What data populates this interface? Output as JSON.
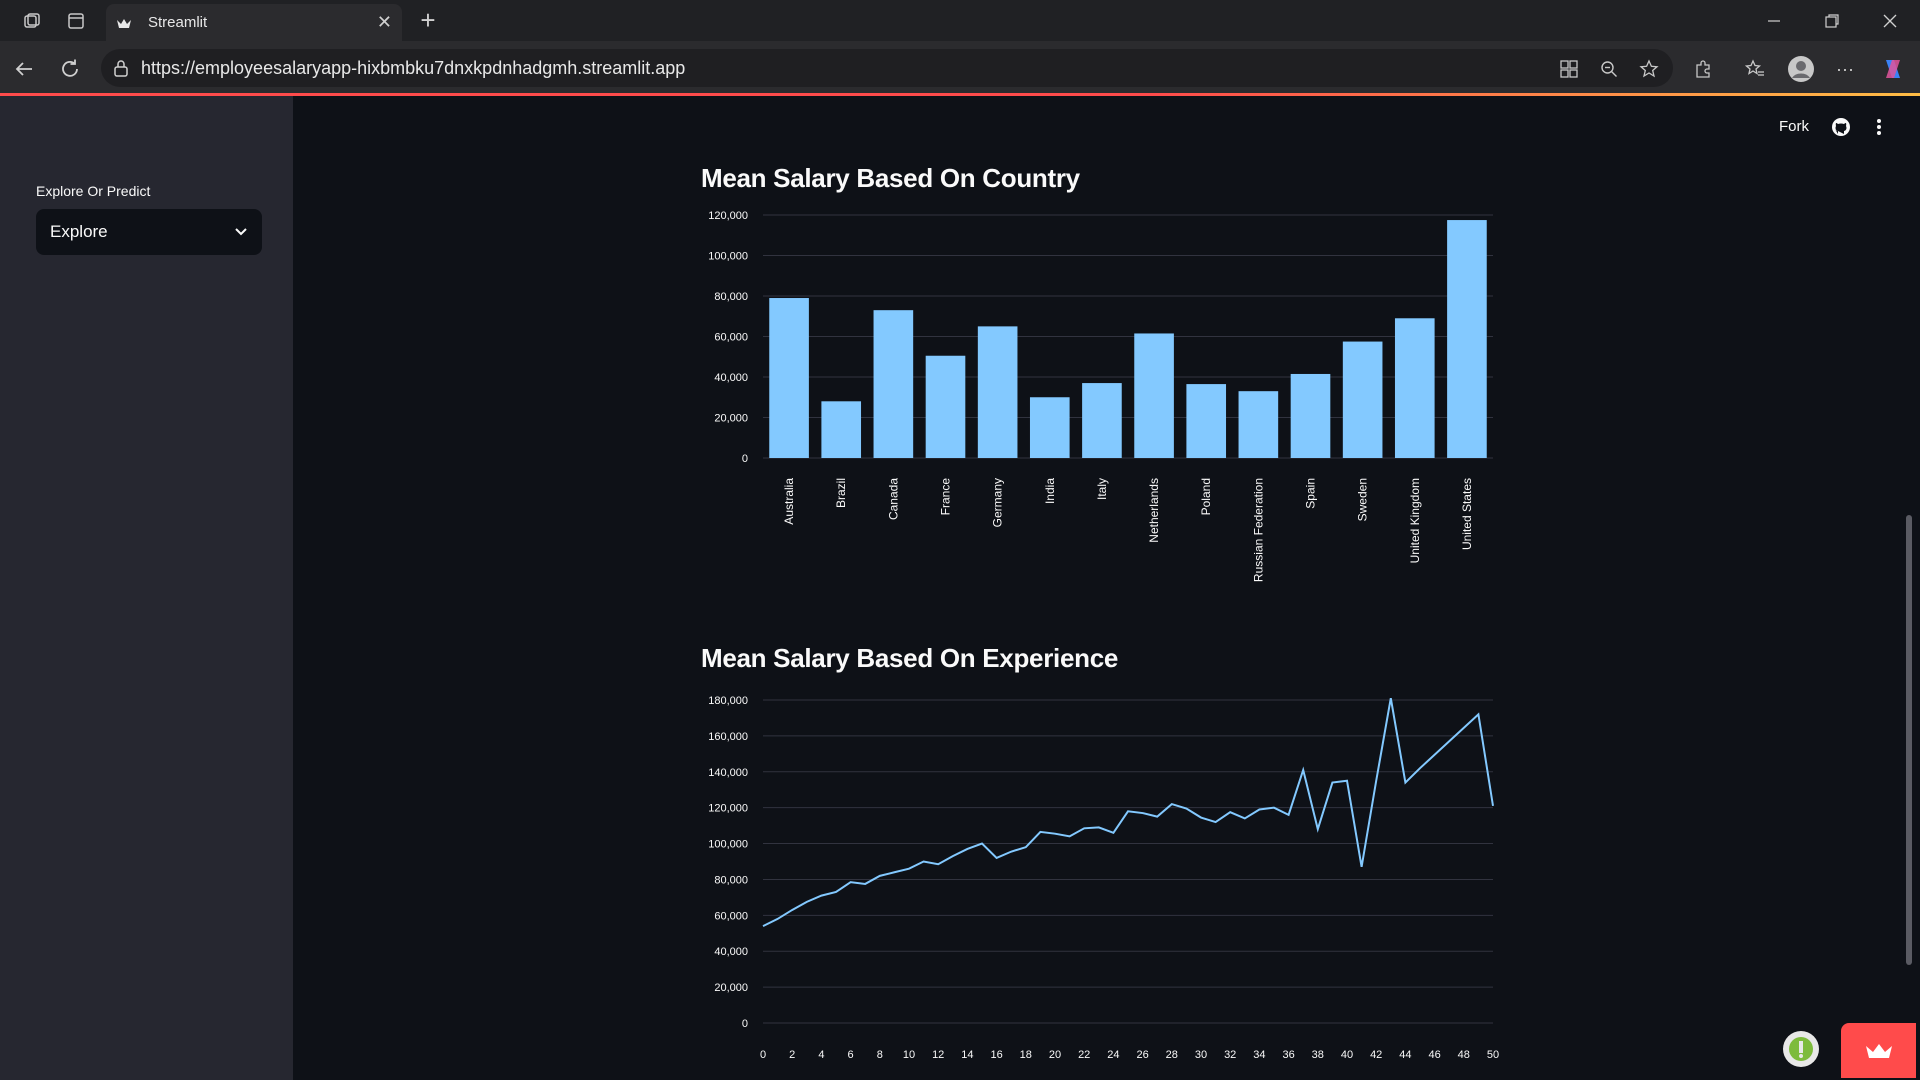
{
  "browser": {
    "tab_title": "Streamlit",
    "url": "https://employeesalaryapp-hixbmbku7dnxkpdnhadgmh.streamlit.app"
  },
  "sidebar": {
    "select_label": "Explore Or Predict",
    "select_value": "Explore"
  },
  "header": {
    "fork_label": "Fork"
  },
  "colors": {
    "accent": "#ff4b4b",
    "bar": "#83c9ff",
    "background": "#0e1117",
    "sidebar": "#262730"
  },
  "chart_data": [
    {
      "type": "bar",
      "title": "Mean Salary Based On Country",
      "categories": [
        "Australia",
        "Brazil",
        "Canada",
        "France",
        "Germany",
        "India",
        "Italy",
        "Netherlands",
        "Poland",
        "Russian Federation",
        "Spain",
        "Sweden",
        "United Kingdom",
        "United States"
      ],
      "values": [
        79000,
        28000,
        73000,
        50500,
        65000,
        30000,
        37000,
        61500,
        36500,
        33000,
        41500,
        57500,
        69000,
        117500
      ],
      "yticks": [
        "0",
        "20,000",
        "40,000",
        "60,000",
        "80,000",
        "100,000",
        "120,000"
      ],
      "ylim": [
        0,
        120000
      ],
      "grid": true
    },
    {
      "type": "line",
      "title": "Mean Salary Based On Experience",
      "x": [
        0,
        1,
        2,
        3,
        4,
        5,
        6,
        7,
        8,
        9,
        10,
        11,
        12,
        13,
        14,
        15,
        16,
        17,
        18,
        19,
        20,
        21,
        22,
        23,
        24,
        25,
        26,
        27,
        28,
        29,
        30,
        31,
        32,
        33,
        34,
        35,
        36,
        37,
        38,
        39,
        40,
        41,
        42,
        43,
        44,
        45,
        49,
        50
      ],
      "values": [
        54000,
        58000,
        63000,
        67500,
        71000,
        73000,
        78500,
        77500,
        82000,
        84000,
        86000,
        90000,
        88500,
        93000,
        97000,
        100000,
        92000,
        95500,
        98000,
        106500,
        105500,
        104000,
        108500,
        109000,
        106000,
        118000,
        117000,
        115000,
        122000,
        119500,
        114500,
        112000,
        117500,
        114000,
        119000,
        120000,
        116000,
        141000,
        108000,
        134000,
        135000,
        87000,
        135000,
        181000,
        134000,
        142000,
        172000,
        121000
      ],
      "xticks": [
        "0",
        "2",
        "4",
        "6",
        "8",
        "10",
        "12",
        "14",
        "16",
        "18",
        "20",
        "22",
        "24",
        "26",
        "28",
        "30",
        "32",
        "34",
        "36",
        "38",
        "40",
        "42",
        "44",
        "46",
        "48",
        "50"
      ],
      "yticks": [
        "0",
        "20,000",
        "40,000",
        "60,000",
        "80,000",
        "100,000",
        "120,000",
        "140,000",
        "160,000",
        "180,000"
      ],
      "ylim": [
        0,
        180000
      ],
      "grid": true
    }
  ]
}
